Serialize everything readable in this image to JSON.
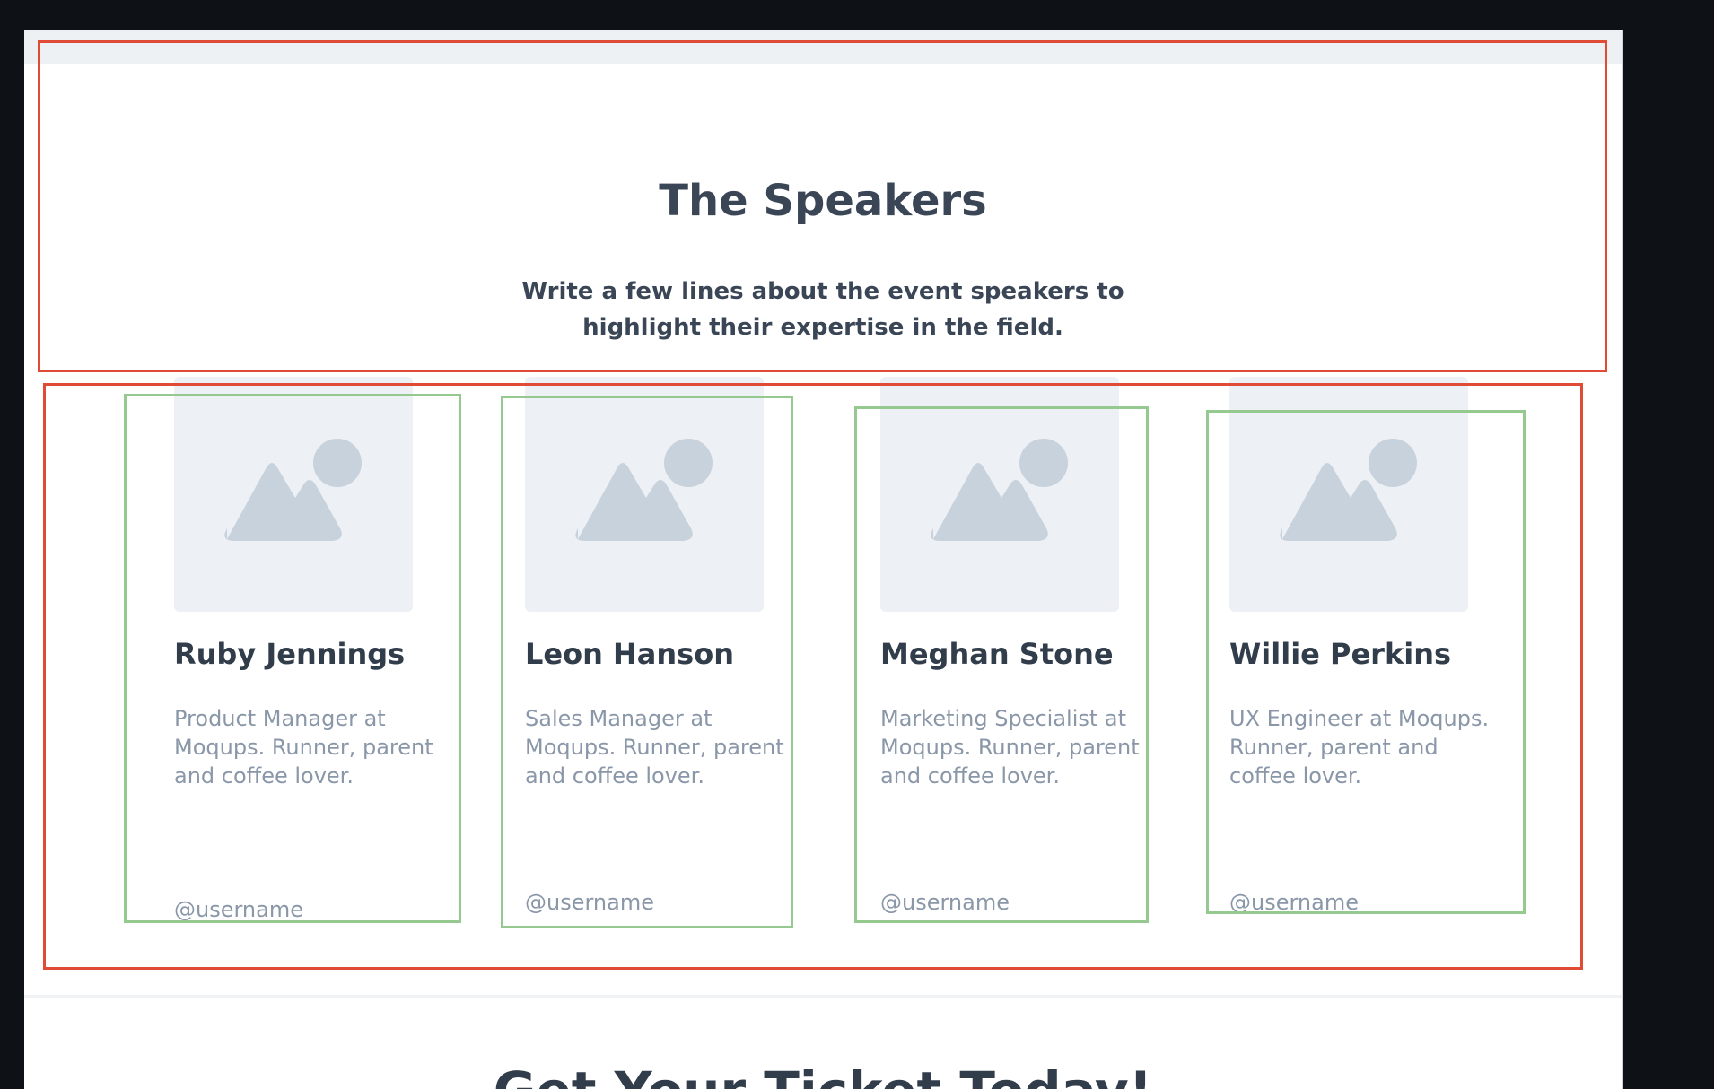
{
  "header": {
    "title": "The Speakers",
    "subtitle": "Write a few lines about the event speakers to highlight their expertise in the field."
  },
  "speakers": [
    {
      "name": "Ruby Jennings",
      "description": "Product Manager at Moqups. Runner, parent and coffee lover.",
      "username": "@username"
    },
    {
      "name": "Leon Hanson",
      "description": "Sales Manager at Moqups.  Runner, parent and coffee lover.",
      "username": "@username"
    },
    {
      "name": "Meghan Stone",
      "description": "Marketing Specialist at Moqups. Runner, parent and coffee lover.",
      "username": "@username"
    },
    {
      "name": "Willie Perkins",
      "description": "UX Engineer at Moqups. Runner, parent and coffee lover.",
      "username": "@username"
    }
  ],
  "next_section": {
    "title": "Get Your Ticket Today!"
  },
  "colors": {
    "frame_background": "#0e1116",
    "heading": "#3a4656",
    "muted_text": "#8a97a8",
    "placeholder_bg": "#edf0f4",
    "placeholder_icon": "#c8d2dc",
    "annotation_red": "#e04b35",
    "annotation_green": "#96c98f"
  },
  "icons": {
    "photo_placeholder": "image-placeholder-icon"
  }
}
